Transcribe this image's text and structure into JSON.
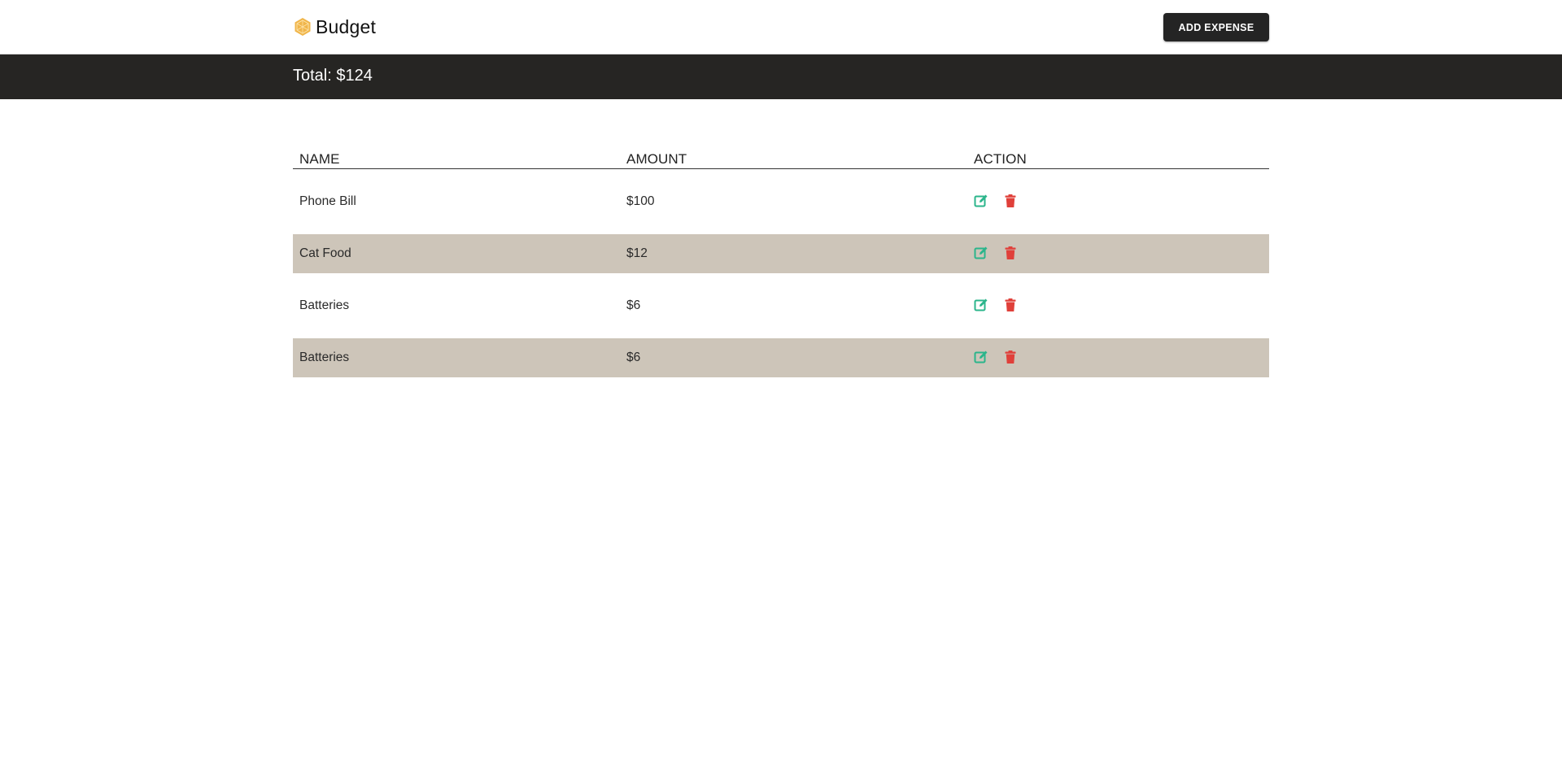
{
  "header": {
    "title": "Budget",
    "logo_icon": "budget-logo-icon",
    "add_button_label": "ADD EXPENSE"
  },
  "summary": {
    "total_label": "Total: $124"
  },
  "table": {
    "columns": [
      "NAME",
      "AMOUNT",
      "ACTION"
    ],
    "rows": [
      {
        "name": "Phone Bill",
        "amount": "$100"
      },
      {
        "name": "Cat Food",
        "amount": "$12"
      },
      {
        "name": "Batteries",
        "amount": "$6"
      },
      {
        "name": "Batteries",
        "amount": "$6"
      }
    ],
    "action_icons": [
      "edit-icon",
      "trash-icon"
    ]
  },
  "colors": {
    "topbar_bg": "#ffffff",
    "totalbar_bg": "#262523",
    "button_bg": "#242424",
    "row_alt_bg": "#cdc5b9",
    "edit_icon": "#2bb58b",
    "delete_icon": "#e0403a",
    "logo": "#f0b54a"
  }
}
